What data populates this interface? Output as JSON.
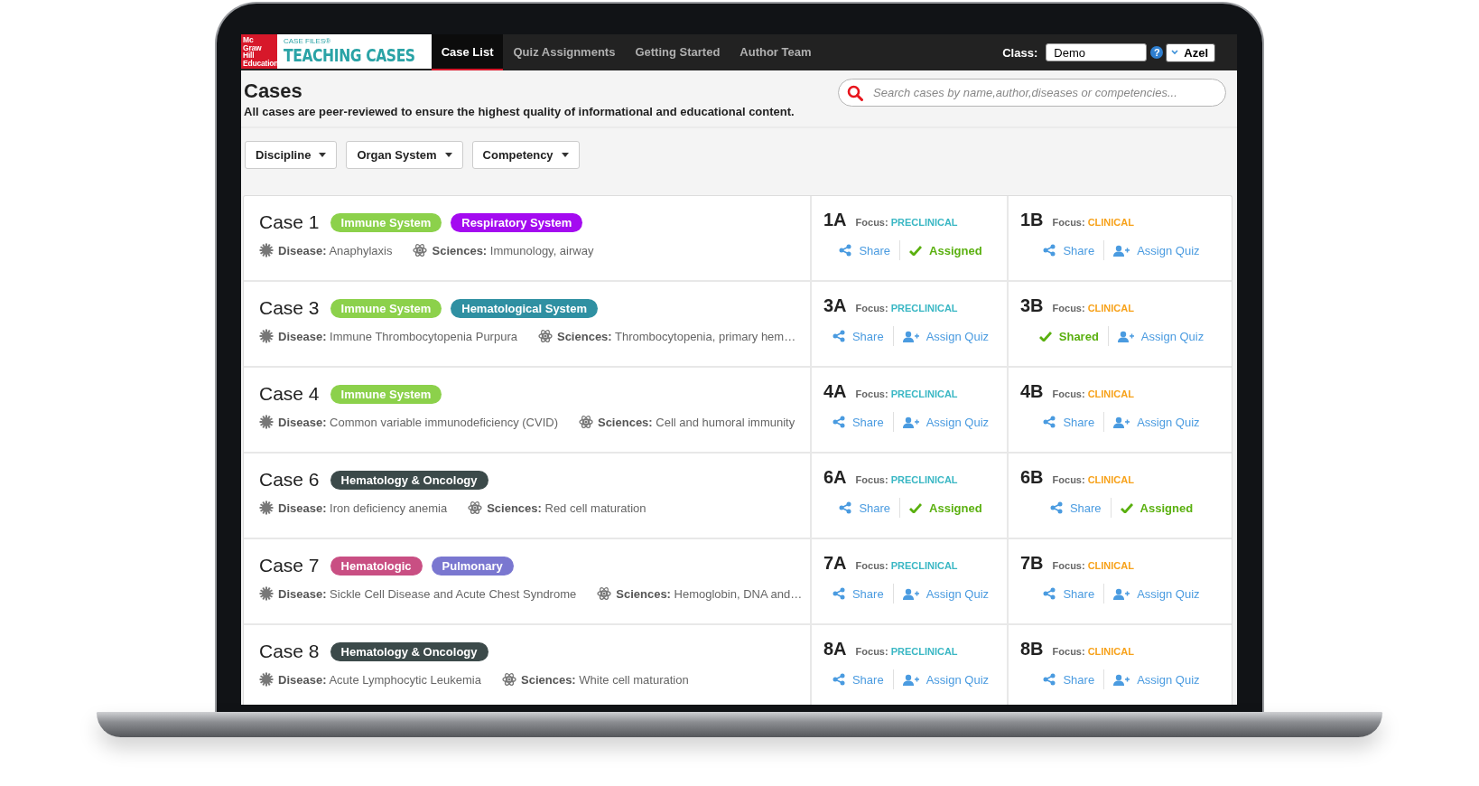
{
  "logo": {
    "mark": "Mc\nGraw\nHill\nEducation",
    "series": "CASE FILES®",
    "title": "TEACHING CASES"
  },
  "nav": {
    "tabs": [
      {
        "label": "Case List",
        "selected": true
      },
      {
        "label": "Quiz Assignments",
        "selected": false
      },
      {
        "label": "Getting Started",
        "selected": false
      },
      {
        "label": "Author Team",
        "selected": false
      }
    ],
    "class_label": "Class:",
    "class_value": "Demo",
    "help": "?",
    "user": "Azel"
  },
  "header": {
    "title": "Cases",
    "description": "All cases are peer-reviewed to ensure the highest quality of informational and educational content.",
    "search": {
      "placeholder": "Search cases by name,author,diseases or competencies..."
    }
  },
  "filters": [
    {
      "label": "Discipline"
    },
    {
      "label": "Organ System"
    },
    {
      "label": "Competency"
    }
  ],
  "cases": [
    {
      "title": "Case 1",
      "tags": [
        {
          "label": "Immune System",
          "color": "#8cd14b"
        },
        {
          "label": "Respiratory System",
          "color": "#a40bf0"
        }
      ],
      "disease": "**Disease:** Anaphylaxis",
      "sciences": "**Sciences:** Immunology, airway",
      "parts": [
        {
          "code": "1A",
          "focus_label": "Focus:",
          "focus": "PRECLINICAL",
          "color": "#3ab7c4",
          "actions": [
            {
              "kind": "share",
              "label": "Share",
              "done": false
            },
            {
              "kind": "assign",
              "label": "Assigned",
              "done": true
            }
          ]
        },
        {
          "code": "1B",
          "focus_label": "Focus:",
          "focus": "CLINICAL",
          "color": "#f7a21b",
          "actions": [
            {
              "kind": "share",
              "label": "Share",
              "done": false
            },
            {
              "kind": "assign",
              "label": "Assign Quiz",
              "done": false
            }
          ]
        }
      ]
    },
    {
      "title": "Case 3",
      "tags": [
        {
          "label": "Immune System",
          "color": "#8cd14b"
        },
        {
          "label": "Hematological System",
          "color": "#2f90a2"
        }
      ],
      "disease": "**Disease:** Immune Thrombocytopenia Purpura",
      "sciences": "**Sciences:** Thrombocytopenia, primary hem…",
      "parts": [
        {
          "code": "3A",
          "focus_label": "Focus:",
          "focus": "PRECLINICAL",
          "color": "#3ab7c4",
          "actions": [
            {
              "kind": "share",
              "label": "Share",
              "done": false
            },
            {
              "kind": "assign",
              "label": "Assign Quiz",
              "done": false
            }
          ]
        },
        {
          "code": "3B",
          "focus_label": "Focus:",
          "focus": "CLINICAL",
          "color": "#f7a21b",
          "actions": [
            {
              "kind": "share",
              "label": "Shared",
              "done": true
            },
            {
              "kind": "assign",
              "label": "Assign Quiz",
              "done": false
            }
          ]
        }
      ]
    },
    {
      "title": "Case 4",
      "tags": [
        {
          "label": "Immune System",
          "color": "#8cd14b"
        }
      ],
      "disease": "**Disease:** Common variable immunodeficiency (CVID)",
      "sciences": "**Sciences:** Cell and humoral immunity",
      "parts": [
        {
          "code": "4A",
          "focus_label": "Focus:",
          "focus": "PRECLINICAL",
          "color": "#3ab7c4",
          "actions": [
            {
              "kind": "share",
              "label": "Share",
              "done": false
            },
            {
              "kind": "assign",
              "label": "Assign Quiz",
              "done": false
            }
          ]
        },
        {
          "code": "4B",
          "focus_label": "Focus:",
          "focus": "CLINICAL",
          "color": "#f7a21b",
          "actions": [
            {
              "kind": "share",
              "label": "Share",
              "done": false
            },
            {
              "kind": "assign",
              "label": "Assign Quiz",
              "done": false
            }
          ]
        }
      ]
    },
    {
      "title": "Case 6",
      "tags": [
        {
          "label": "Hematology & Oncology",
          "color": "#3c4a4a"
        }
      ],
      "disease": "**Disease:** Iron deficiency anemia",
      "sciences": "**Sciences:** Red cell maturation",
      "parts": [
        {
          "code": "6A",
          "focus_label": "Focus:",
          "focus": "PRECLINICAL",
          "color": "#3ab7c4",
          "actions": [
            {
              "kind": "share",
              "label": "Share",
              "done": false
            },
            {
              "kind": "assign",
              "label": "Assigned",
              "done": true
            }
          ]
        },
        {
          "code": "6B",
          "focus_label": "Focus:",
          "focus": "CLINICAL",
          "color": "#f7a21b",
          "actions": [
            {
              "kind": "share",
              "label": "Share",
              "done": false
            },
            {
              "kind": "assign",
              "label": "Assigned",
              "done": true
            }
          ]
        }
      ]
    },
    {
      "title": "Case 7",
      "tags": [
        {
          "label": "Hematologic",
          "color": "#c94f83"
        },
        {
          "label": "Pulmonary",
          "color": "#7a77d0"
        }
      ],
      "disease": "**Disease:** Sickle Cell Disease and Acute Chest Syndrome",
      "sciences": "**Sciences:** Hemoglobin, DNA and…",
      "parts": [
        {
          "code": "7A",
          "focus_label": "Focus:",
          "focus": "PRECLINICAL",
          "color": "#3ab7c4",
          "actions": [
            {
              "kind": "share",
              "label": "Share",
              "done": false
            },
            {
              "kind": "assign",
              "label": "Assign Quiz",
              "done": false
            }
          ]
        },
        {
          "code": "7B",
          "focus_label": "Focus:",
          "focus": "CLINICAL",
          "color": "#f7a21b",
          "actions": [
            {
              "kind": "share",
              "label": "Share",
              "done": false
            },
            {
              "kind": "assign",
              "label": "Assign Quiz",
              "done": false
            }
          ]
        }
      ]
    },
    {
      "title": "Case 8",
      "tags": [
        {
          "label": "Hematology & Oncology",
          "color": "#3c4a4a"
        }
      ],
      "disease": "**Disease:** Acute Lymphocytic Leukemia",
      "sciences": "**Sciences:** White cell maturation",
      "parts": [
        {
          "code": "8A",
          "focus_label": "Focus:",
          "focus": "PRECLINICAL",
          "color": "#3ab7c4",
          "actions": [
            {
              "kind": "share",
              "label": "Share",
              "done": false
            },
            {
              "kind": "assign",
              "label": "Assign Quiz",
              "done": false
            }
          ]
        },
        {
          "code": "8B",
          "focus_label": "Focus:",
          "focus": "CLINICAL",
          "color": "#f7a21b",
          "actions": [
            {
              "kind": "share",
              "label": "Share",
              "done": false
            },
            {
              "kind": "assign",
              "label": "Assign Quiz",
              "done": false
            }
          ]
        }
      ]
    }
  ]
}
